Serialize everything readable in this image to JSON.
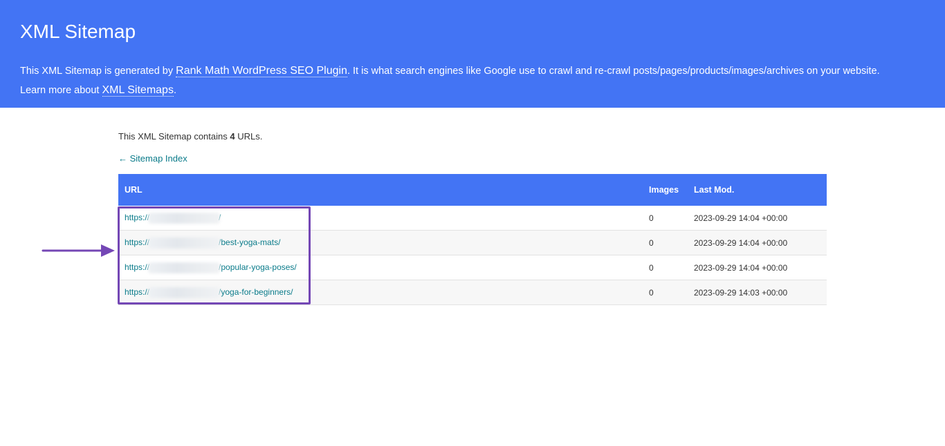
{
  "header": {
    "title": "XML Sitemap",
    "desc_prefix": "This XML Sitemap is generated by ",
    "plugin_link": "Rank Math WordPress SEO Plugin",
    "desc_middle": ". It is what search engines like Google use to crawl and re-crawl posts/pages/products/images/archives on your website.",
    "learn_prefix": "Learn more about ",
    "learn_link": "XML Sitemaps",
    "learn_suffix": "."
  },
  "content": {
    "count_prefix": "This XML Sitemap contains ",
    "count_value": "4",
    "count_suffix": " URLs.",
    "back_link": "← Sitemap Index"
  },
  "table": {
    "headers": {
      "url": "URL",
      "images": "Images",
      "last_mod": "Last Mod."
    },
    "rows": [
      {
        "url_prefix": "https://",
        "url_suffix": "/",
        "images": "0",
        "last_mod": "2023-09-29 14:04 +00:00"
      },
      {
        "url_prefix": "https://",
        "url_suffix": "/best-yoga-mats/",
        "images": "0",
        "last_mod": "2023-09-29 14:04 +00:00"
      },
      {
        "url_prefix": "https://",
        "url_suffix": "/popular-yoga-poses/",
        "images": "0",
        "last_mod": "2023-09-29 14:04 +00:00"
      },
      {
        "url_prefix": "https://",
        "url_suffix": "/yoga-for-beginners/",
        "images": "0",
        "last_mod": "2023-09-29 14:03 +00:00"
      }
    ]
  },
  "colors": {
    "header_bg": "#4374f4",
    "link": "#0a7b8a",
    "annotation": "#7447b5"
  }
}
